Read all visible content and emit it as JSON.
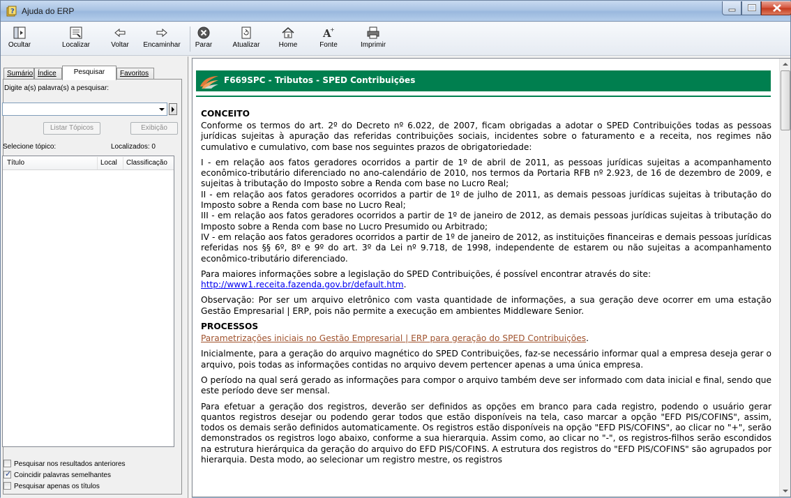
{
  "window": {
    "title": "Ajuda do ERP",
    "controls": [
      "minimize-icon",
      "maximize-icon",
      "close-icon"
    ]
  },
  "toolbar": {
    "buttons": [
      {
        "label": "Ocultar",
        "icon": "hide-pane-icon"
      },
      {
        "label": "Localizar",
        "icon": "locate-icon"
      },
      {
        "label": "Voltar",
        "icon": "back-arrow-icon"
      },
      {
        "label": "Encaminhar",
        "icon": "forward-arrow-icon"
      },
      {
        "label": "Parar",
        "icon": "stop-icon"
      },
      {
        "label": "Atualizar",
        "icon": "refresh-icon"
      },
      {
        "label": "Home",
        "icon": "home-icon"
      },
      {
        "label": "Fonte",
        "icon": "font-icon"
      },
      {
        "label": "Imprimir",
        "icon": "print-icon"
      }
    ]
  },
  "left_pane": {
    "tabs": [
      {
        "label": "Sumário",
        "active": false
      },
      {
        "label": "Índice",
        "active": false
      },
      {
        "label": "Pesquisar",
        "active": true
      },
      {
        "label": "Favoritos",
        "active": false
      }
    ],
    "search_prompt": "Digite a(s) palavra(s) a pesquisar:",
    "search_value": "",
    "list_topics_button": "Listar Tópicos",
    "display_button": "Exibição",
    "select_topic_label": "Selecione tópico:",
    "found_label": "Localizados: 0",
    "columns": [
      "Título",
      "Local",
      "Classificação"
    ],
    "options": [
      {
        "label": "Pesquisar nos resultados anteriores",
        "checked": false
      },
      {
        "label": "Coincidir palavras semelhantes",
        "checked": true
      },
      {
        "label": "Pesquisar apenas os títulos",
        "checked": false
      }
    ]
  },
  "content": {
    "banner_title": "F669SPC - Tributos - SPED Contribuições",
    "brand_color": "#007f4f",
    "section1_title": "CONCEITO",
    "p1": "Conforme os termos do art. 2º do Decreto nº 6.022, de 2007, ficam obrigadas a adotar o SPED Contribuições todas as pessoas jurídicas sujeitas à apuração das referidas contribuições sociais, incidentes sobre o faturamento e a receita, nos regimes não cumulativo e cumulativo, com base nos seguintes prazos de obrigatoriedade:",
    "item1": "I - em relação aos fatos geradores ocorridos a partir de 1º de abril de 2011, as pessoas jurídicas sujeitas a acompanhamento econômico-tributário diferenciado no ano-calendário de 2010, nos termos da Portaria RFB nº 2.923, de 16 de dezembro de 2009, e sujeitas à tributação do Imposto sobre a Renda com base no Lucro Real;",
    "item2": "II - em relação aos fatos geradores ocorridos a partir de 1º de julho de 2011, as demais pessoas jurídicas sujeitas à tributação do Imposto sobre a Renda com base no Lucro Real;",
    "item3": "III - em relação aos fatos geradores ocorridos a partir de 1º de janeiro de 2012, as demais pessoas jurídicas sujeitas à tributação do Imposto sobre a Renda com base no Lucro Presumido ou Arbitrado;",
    "item4": "IV - em relação aos fatos geradores ocorridos a partir de 1º de janeiro de 2012, as instituições financeiras e demais pessoas jurídicas referidas nos §§ 6º, 8º e 9º do art. 3º da Lei nº 9.718, de 1998, independente de estarem ou não sujeitas a acompanhamento econômico-tributário diferenciado.",
    "p_more": "Para maiores informações sobre a legislação do SPED Contribuições, é possível encontrar através do site:",
    "link_url": "http://www1.receita.fazenda.gov.br/default.htm",
    "link_suffix": ".",
    "p_obs": "Observação: Por ser um arquivo eletrônico com vasta quantidade de informações, a sua geração deve ocorrer em uma estação Gestão Empresarial | ERP, pois não permite a execução em ambientes Middleware Senior.",
    "section2_title": "PROCESSOS",
    "link_param": "Parametrizações iniciais no Gestão Empresarial | ERP para geração do SPED Contribuições",
    "link_param_suffix": ".",
    "p_ini": "Inicialmente, para a geração do arquivo magnético do SPED Contribuições, faz-se necessário informar qual a empresa deseja gerar o arquivo, pois todas as informações contidas no arquivo devem pertencer apenas a uma única empresa.",
    "p_periodo": "O período na qual será gerado as informações para compor o arquivo também deve ser informado com data inicial e final, sendo que este período deve ser mensal.",
    "p_registros": "Para efetuar a geração dos registros, deverão ser definidos as opções em branco para cada registro, podendo o usuário gerar quantos registros desejar ou podendo gerar todos que estão disponíveis na tela, caso marcar a opção \"EFD PIS/COFINS\", assim, todos os demais serão definidos automaticamente. Os registros estão disponíveis na opção \"EFD PIS/COFINS\", ao clicar no \"+\", serão demonstrados os registros logo abaixo, conforme a sua hierarquia. Assim como, ao clicar no \"-\", os registros-filhos serão escondidos na estrutura hierárquica da geração do arquivo do EFD PIS/COFINS. A estrutura dos registros do \"EFD PIS/COFINS\" são agrupados por hierarquia. Desta modo, ao selecionar um registro mestre, os registros"
  }
}
